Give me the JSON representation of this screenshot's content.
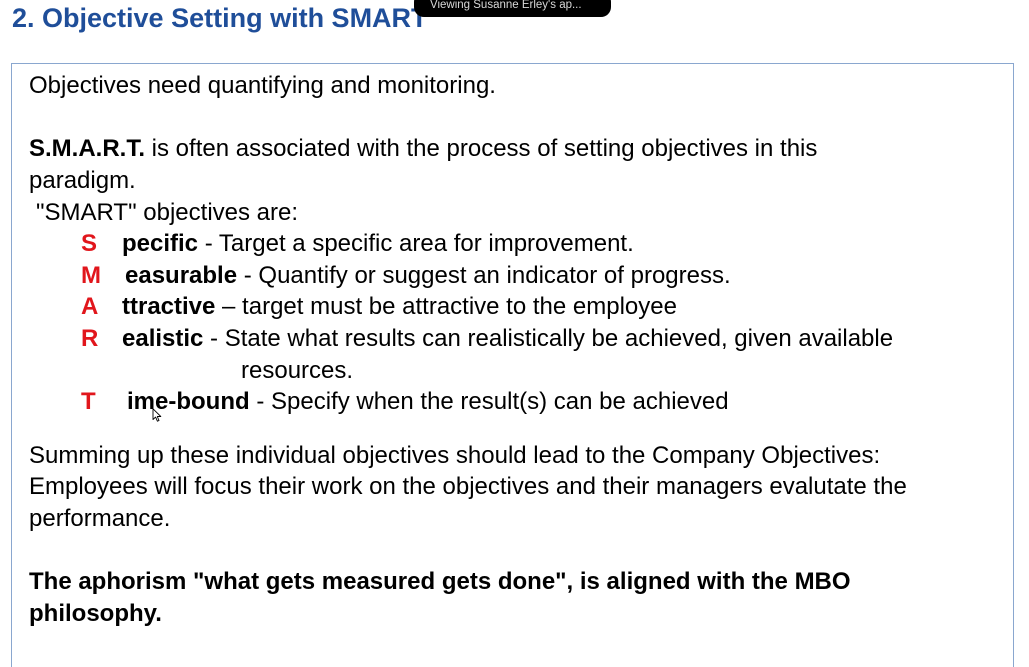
{
  "title": "2. Objective Setting with SMART",
  "share_banner": "Viewing Susanne Erley's ap...",
  "body": {
    "intro": "Objectives need quantifying and monitoring.",
    "smart_bold": "S.M.A.R.T.",
    "smart_rest_1": " is often associated with the process of setting objectives in this",
    "smart_rest_2": "paradigm.",
    "smart_objectives_label": "\"SMART\" objectives are:",
    "items": [
      {
        "letter": "S",
        "word": "pecific",
        "desc": " - Target a specific area for improvement."
      },
      {
        "letter": "M",
        "word": "easurable",
        "desc": " - Quantify or suggest an indicator of progress."
      },
      {
        "letter": "A",
        "word": "ttractive",
        "desc": " – target must be attractive to the employee"
      },
      {
        "letter": "R",
        "word": "ealistic",
        "desc": " - State what results can realistically be achieved, given available",
        "desc_cont": "resources."
      },
      {
        "letter": "T",
        "word": "ime-bound",
        "desc": " - Specify when the result(s) can be achieved"
      }
    ],
    "summary_1": "Summing up these individual objectives should lead to the Company Objectives:",
    "summary_2": "Employees will focus their work on the objectives and their managers evalutate the",
    "summary_3": "performance.",
    "aphorism_1": "The aphorism \"what gets measured gets done\", is aligned with the MBO",
    "aphorism_2": "philosophy."
  },
  "colors": {
    "title": "#1f4e99",
    "letter": "#e1161c",
    "box_border": "#8aa7cf"
  }
}
